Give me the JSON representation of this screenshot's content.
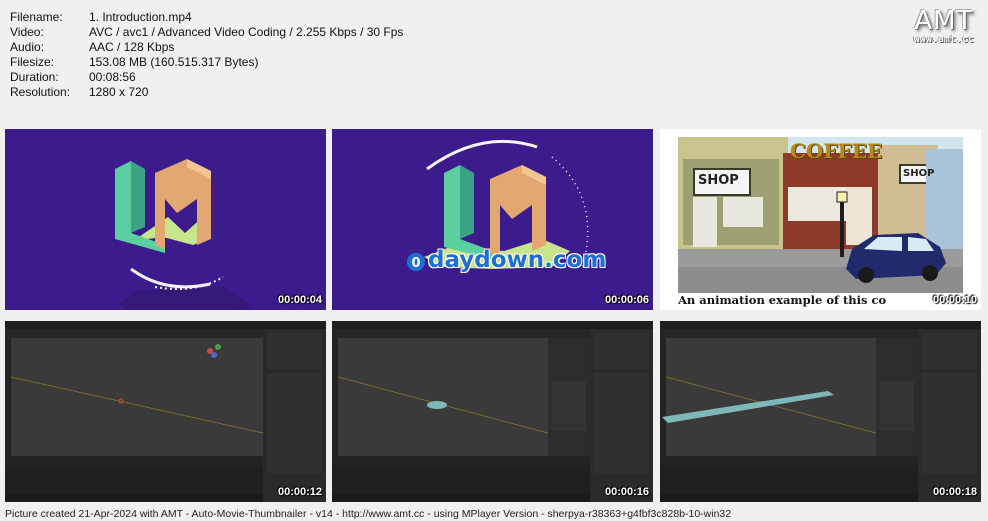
{
  "info": {
    "rows": [
      {
        "label": "Filename:",
        "value": "1. Introduction.mp4"
      },
      {
        "label": "Video:",
        "value": "AVC / avc1 / Advanced Video Coding / 2.255 Kbps / 30 Fps"
      },
      {
        "label": "Audio:",
        "value": "AAC / 128 Kbps"
      },
      {
        "label": "Filesize:",
        "value": "153.08 MB (160.515.317 Bytes)"
      },
      {
        "label": "Duration:",
        "value": "00:08:56"
      },
      {
        "label": "Resolution:",
        "value": "1280 x 720"
      }
    ]
  },
  "logo": {
    "title": "AMT",
    "url": "www.amt.cc"
  },
  "thumbs": [
    {
      "time": "00:00:04"
    },
    {
      "time": "00:00:06",
      "watermark": "daydown.com"
    },
    {
      "time": "00:00:10",
      "caption": "An animation example of this co",
      "signs": [
        "SHOP",
        "COFFEE",
        "SHOP"
      ]
    },
    {
      "time": "00:00:12"
    },
    {
      "time": "00:00:16"
    },
    {
      "time": "00:00:18"
    }
  ],
  "footer": "Picture created 21-Apr-2024 with AMT - Auto-Movie-Thumbnailer - v14 - http://www.amt.cc - using MPlayer Version - sherpya-r38363+g4fbf3c828b-10-win32",
  "colors": {
    "background": "#f0f0f0",
    "intro_bg": "#3c1c8c",
    "blender_bg": "#2b2b2b"
  }
}
